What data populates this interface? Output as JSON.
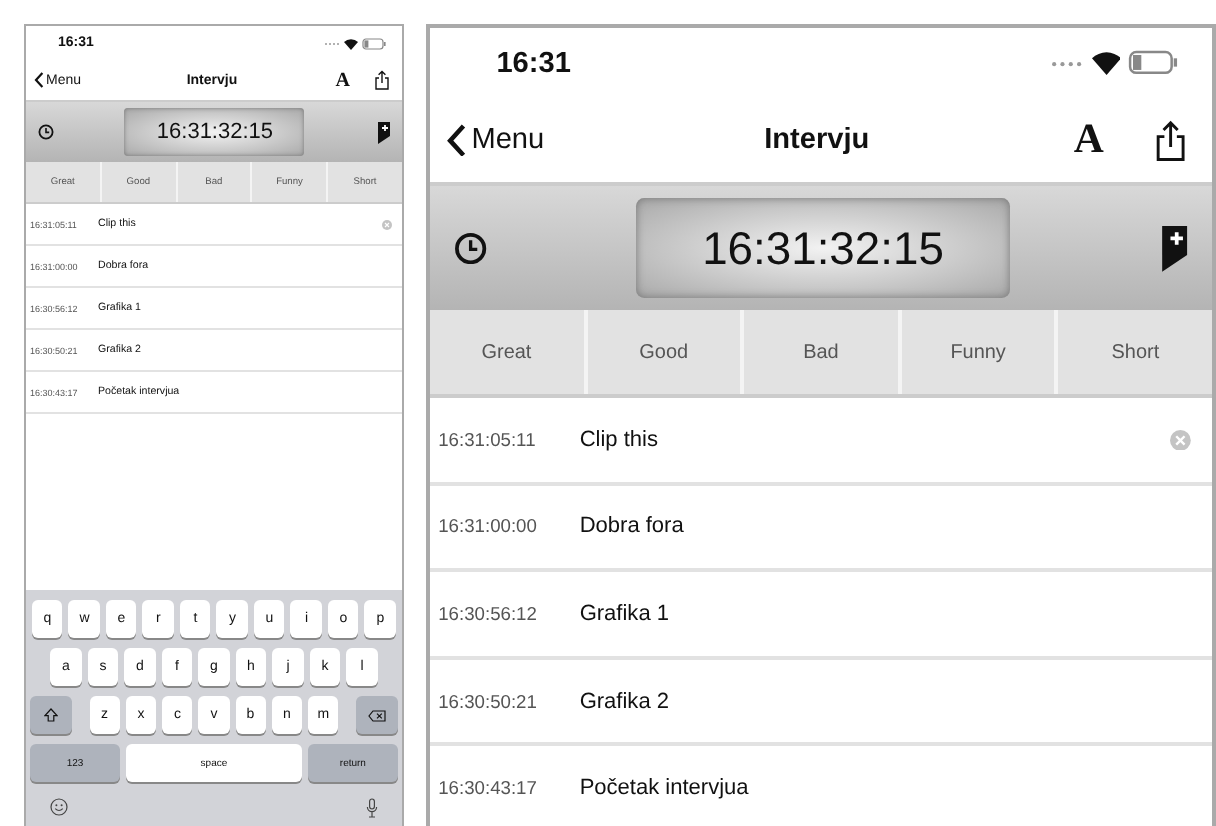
{
  "screens": [
    {
      "status_bar": {
        "time": "16:31"
      },
      "nav": {
        "back": "Menu",
        "title": "Intervju",
        "font_button": "A"
      },
      "timecode": "16:31:32:15",
      "tags": [
        "Great",
        "Good",
        "Bad",
        "Funny",
        "Short"
      ],
      "clips": [
        {
          "time": "16:31:05:11",
          "title": "Clip this",
          "editing": true
        },
        {
          "time": "16:31:00:00",
          "title": "Dobra fora",
          "editing": false
        },
        {
          "time": "16:30:56:12",
          "title": "Grafika 1",
          "editing": false
        },
        {
          "time": "16:30:50:21",
          "title": "Grafika 2",
          "editing": false
        },
        {
          "time": "16:30:43:17",
          "title": "Početak intervjua",
          "editing": false
        }
      ],
      "keyboard": {
        "rows": [
          [
            "q",
            "w",
            "e",
            "r",
            "t",
            "y",
            "u",
            "i",
            "o",
            "p"
          ],
          [
            "a",
            "s",
            "d",
            "f",
            "g",
            "h",
            "j",
            "k",
            "l"
          ],
          [
            "z",
            "x",
            "c",
            "v",
            "b",
            "n",
            "m"
          ]
        ],
        "numbers_key": "123",
        "space_key": "space",
        "return_key": "return"
      }
    },
    {
      "status_bar": {
        "time": "16:31"
      },
      "nav": {
        "back": "Menu",
        "title": "Intervju",
        "font_button": "A"
      },
      "timecode": "16:31:32:15",
      "tags": [
        "Great",
        "Good",
        "Bad",
        "Funny",
        "Short"
      ],
      "clips": [
        {
          "time": "16:31:05:11",
          "title": "Clip this",
          "editing": true
        },
        {
          "time": "16:31:00:00",
          "title": "Dobra fora",
          "editing": false
        },
        {
          "time": "16:30:56:12",
          "title": "Grafika 1",
          "editing": false
        },
        {
          "time": "16:30:50:21",
          "title": "Grafika 2",
          "editing": false
        },
        {
          "time": "16:30:43:17",
          "title": "Početak intervjua",
          "editing": false
        }
      ]
    }
  ]
}
